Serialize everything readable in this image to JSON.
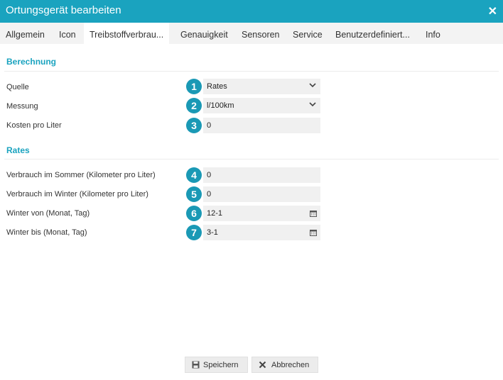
{
  "window": {
    "title": "Ortungsgerät bearbeiten",
    "close_symbol": "✕"
  },
  "tabs": [
    {
      "label": "Allgemein"
    },
    {
      "label": "Icon"
    },
    {
      "label": "Treibstoffverbrau..."
    },
    {
      "label": "Genauigkeit"
    },
    {
      "label": "Sensoren"
    },
    {
      "label": "Service"
    },
    {
      "label": "Benutzerdefiniert..."
    },
    {
      "label": "Info"
    }
  ],
  "sections": {
    "berechnung": "Berechnung",
    "rates": "Rates"
  },
  "fields": [
    {
      "label": "Quelle",
      "value": "Rates",
      "badge": "1",
      "control": "select"
    },
    {
      "label": "Messung",
      "value": "l/100km",
      "badge": "2",
      "control": "select"
    },
    {
      "label": "Kosten pro Liter",
      "value": "0",
      "badge": "3",
      "control": "text"
    },
    {
      "label": "Verbrauch im Sommer (Kilometer pro Liter)",
      "value": "0",
      "badge": "4",
      "control": "text"
    },
    {
      "label": "Verbrauch im Winter (Kilometer pro Liter)",
      "value": "0",
      "badge": "5",
      "control": "text"
    },
    {
      "label": "Winter von (Monat, Tag)",
      "value": "12-1",
      "badge": "6",
      "control": "date"
    },
    {
      "label": "Winter bis (Monat, Tag)",
      "value": "3-1",
      "badge": "7",
      "control": "date"
    }
  ],
  "icons": {
    "select": "chevron-down-icon",
    "date": "calendar-icon",
    "save": "floppy-disk-icon",
    "cancel": "x-icon"
  },
  "buttons": {
    "save": "Speichern",
    "cancel": "Abbrechen"
  },
  "colors": {
    "accent": "#1aa3bf",
    "badge": "#1a99b5",
    "field_bg": "#f0f0f0"
  }
}
